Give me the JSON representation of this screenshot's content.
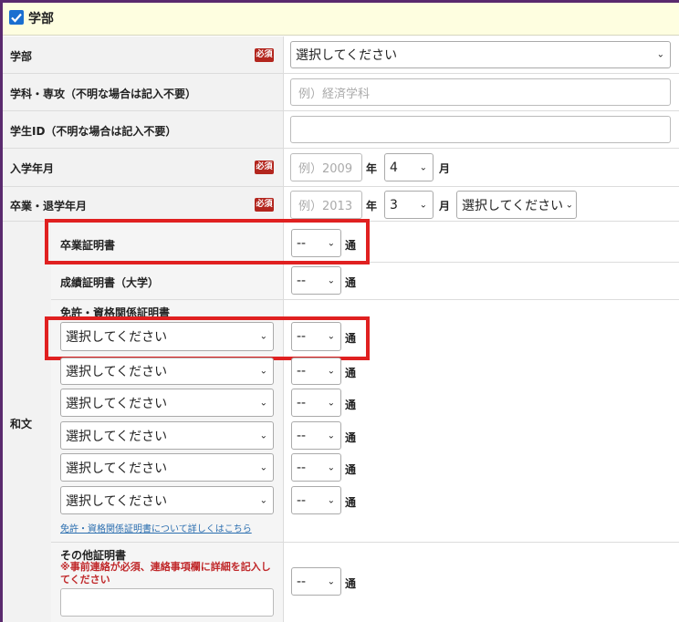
{
  "header": {
    "title": "学部",
    "checked": true
  },
  "required_label": "必須",
  "rows": {
    "faculty": {
      "label": "学部",
      "select_value": "選択してください"
    },
    "department": {
      "label": "学科・専攻（不明な場合は記入不要）",
      "placeholder": "例）経済学科"
    },
    "student_id": {
      "label": "学生ID（不明な場合は記入不要）",
      "value": ""
    },
    "enrollment": {
      "label": "入学年月",
      "year_placeholder": "例）2009",
      "year_unit": "年",
      "month_value": "4",
      "month_unit": "月"
    },
    "graduation": {
      "label": "卒業・退学年月",
      "year_placeholder": "例）2013",
      "year_unit": "年",
      "month_value": "3",
      "month_unit": "月",
      "status_value": "選択してください"
    }
  },
  "japanese": {
    "label": "和文",
    "certificates": [
      {
        "name": "卒業証明書",
        "count": "--",
        "unit": "通"
      },
      {
        "name": "成績証明書（大学）",
        "count": "--",
        "unit": "通"
      }
    ],
    "license_section": {
      "title": "免許・資格関係証明書",
      "items": [
        {
          "select": "選択してください",
          "count": "--",
          "unit": "通"
        },
        {
          "select": "選択してください",
          "count": "--",
          "unit": "通"
        },
        {
          "select": "選択してください",
          "count": "--",
          "unit": "通"
        },
        {
          "select": "選択してください",
          "count": "--",
          "unit": "通"
        },
        {
          "select": "選択してください",
          "count": "--",
          "unit": "通"
        },
        {
          "select": "選択してください",
          "count": "--",
          "unit": "通"
        }
      ],
      "link": "免許・資格関係証明書について詳しくはこちら"
    },
    "other": {
      "title": "その他証明書",
      "note": "※事前連絡が必須、連絡事項欄に詳細を記入してください",
      "input_value": "",
      "count": "--",
      "unit": "通"
    }
  },
  "colors": {
    "required_badge": "#b3261e",
    "highlight_box": "#e02020",
    "checkbox": "#1a6fd0",
    "header_bg": "#fefee0"
  }
}
